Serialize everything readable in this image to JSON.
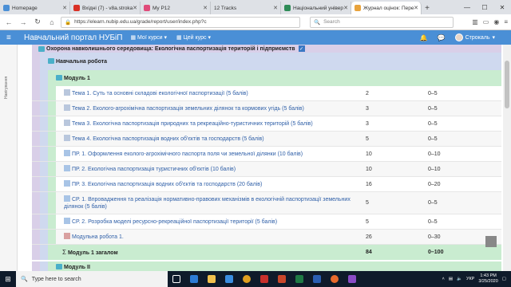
{
  "browser": {
    "tabs": [
      {
        "label": "Homepage",
        "color": "#4a8fd6"
      },
      {
        "label": "Вхідні (7) - v8a.stroka",
        "color": "#d93025"
      },
      {
        "label": "My P12",
        "color": "#e04b7a"
      },
      {
        "label": "12 Tracks",
        "color": "#555555"
      },
      {
        "label": "Національний універ",
        "color": "#2e8b57"
      },
      {
        "label": "Журнал оцінок: Пере",
        "color": "#e8a33c"
      }
    ],
    "url": "https://elearn.nubip.edu.ua/grade/report/user/index.php?c",
    "search_placeholder": "Search"
  },
  "navbar": {
    "brand": "Навчальний портал НУБіП",
    "my_courses": "Мої курси",
    "this_course": "Цей курс",
    "user_name": "Строкаль"
  },
  "sidebar_label": "Навігування",
  "grades": {
    "course": "Охорона навколишнього середовища: Екологічна паспортизація територій і підприємств",
    "category": "Навчальна робота",
    "module": "Модуль 1",
    "items": [
      {
        "name": "Тема 1. Суть та основні складові екологічної паспортизації (5 балів)",
        "weight": "2",
        "range": "0–5"
      },
      {
        "name": "Тема 2. Еколого-агрохімічна паспортизація земельних ділянок та кормових угідь (5 балів)",
        "weight": "3",
        "range": "0–5"
      },
      {
        "name": "Тема 3. Екологічна паспортизація природних та рекреаційно-туристичних територій (5 балів)",
        "weight": "3",
        "range": "0–5"
      },
      {
        "name": "Тема 4. Екологічна паспортизація водних об'єктів та господарств (5 балів)",
        "weight": "5",
        "range": "0–5"
      },
      {
        "name": "ПР. 1. Оформлення еколого-агрохімічного паспорта поля чи земельної ділянки (10 балів)",
        "weight": "10",
        "range": "0–10"
      },
      {
        "name": "ПР. 2. Екологічна паспортизація туристичних об'єктів (10 балів)",
        "weight": "10",
        "range": "0–10"
      },
      {
        "name": "ПР. 3. Екологічна паспортизація водних об'єктів та господарств (20 балів)",
        "weight": "16",
        "range": "0–20"
      },
      {
        "name": "СР. 1. Впровадження та реалізація нормативно-правових механізмів в екологічній паспортизації земельних ділянок (5 балів)",
        "weight": "5",
        "range": "0–5"
      },
      {
        "name": "СР. 2. Розробка моделі ресурсно-рекреаційної паспортизації території (5 балів)",
        "weight": "5",
        "range": "0–5"
      },
      {
        "name": "Модульна робота 1.",
        "weight": "26",
        "range": "0–30"
      }
    ],
    "total_label": "Модуль 1 загалом",
    "total_weight": "84",
    "total_range": "0–100",
    "next_module": "Модуль II"
  },
  "taskbar": {
    "search_placeholder": "Type here to search",
    "lang": "УКР",
    "time": "1:43 PM",
    "date": "3/25/2020"
  }
}
